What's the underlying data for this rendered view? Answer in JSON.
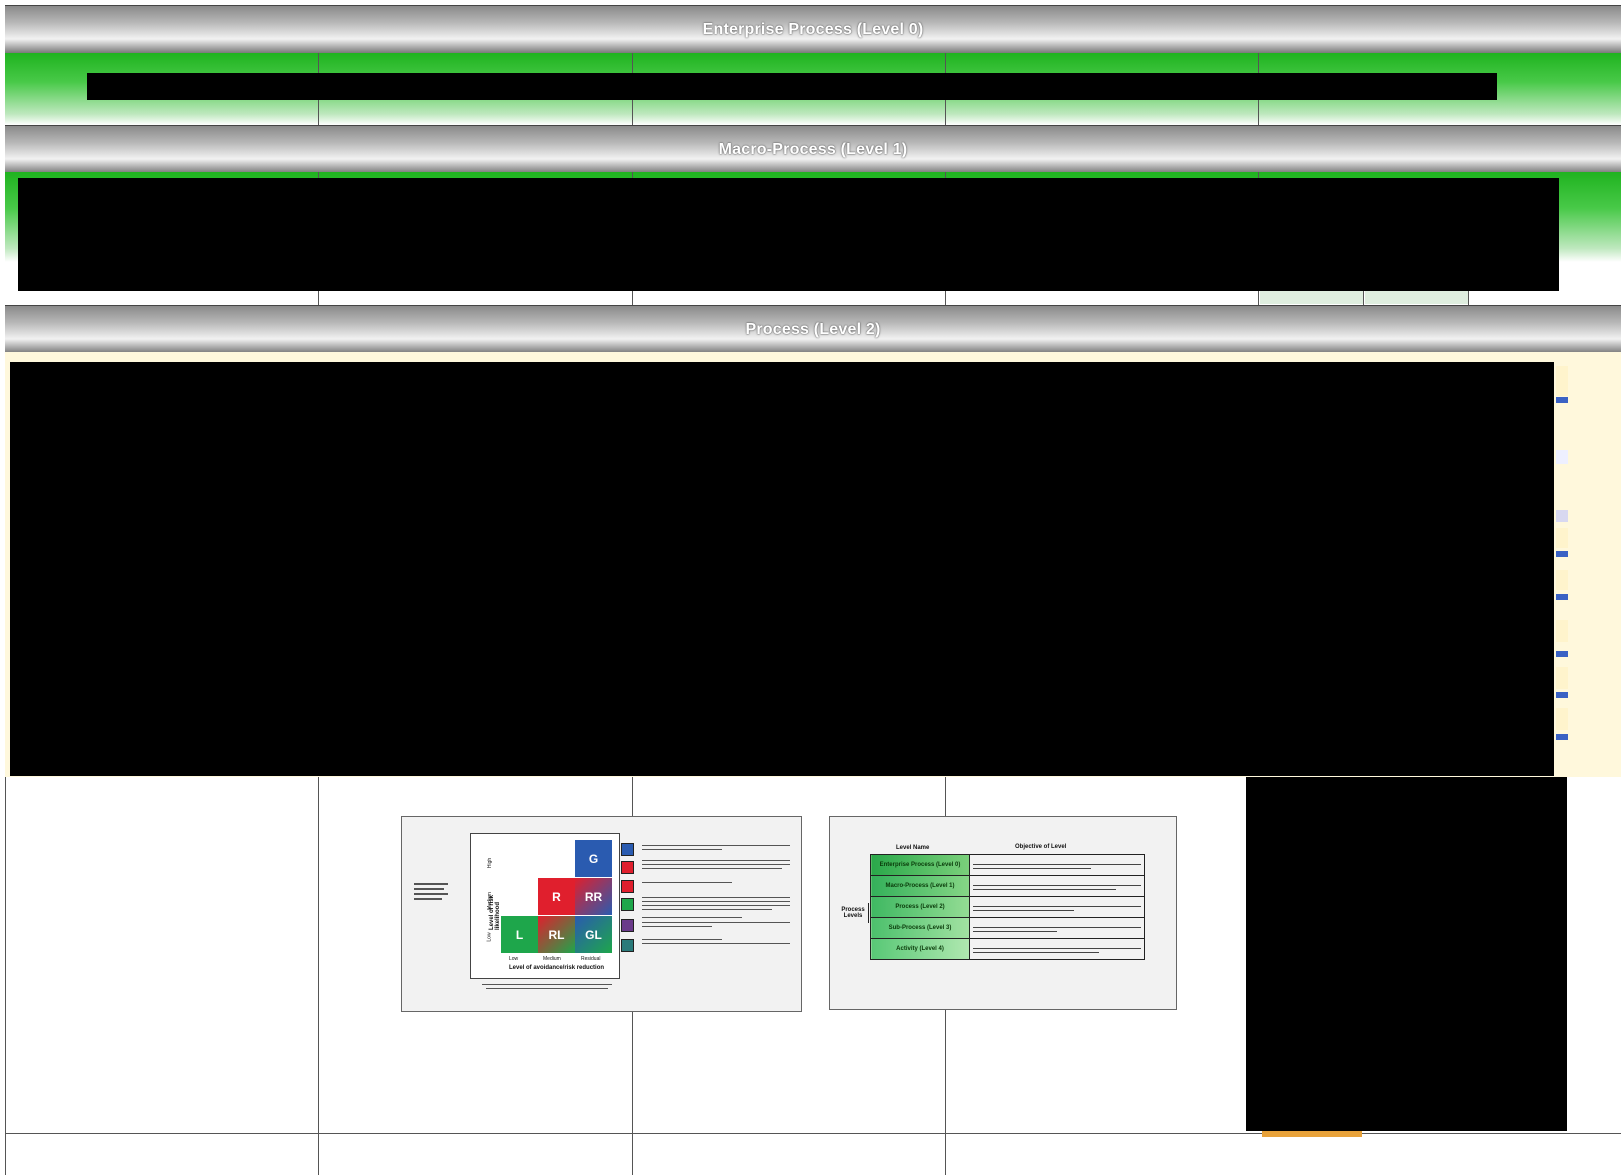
{
  "headers": {
    "level0": "Enterprise Process (Level 0)",
    "level1": "Macro-Process (Level 1)",
    "level2": "Process (Level 2)"
  },
  "risk_matrix": {
    "y_axis_title": "Level of risk likelihood",
    "x_axis_title": "Level of avoidance/risk reduction",
    "x_ticks": [
      "Low",
      "Medium",
      "Residual"
    ],
    "y_ticks": [
      "Low",
      "Medium",
      "High"
    ],
    "cells": {
      "top_right": "G",
      "mid_middle": "R",
      "mid_right": "RR",
      "bottom_left": "L",
      "bottom_middle": "RL",
      "bottom_right": "GL"
    },
    "colors": {
      "blue": "#2a5bb0",
      "red": "#e01f2d",
      "green": "#1ea64b",
      "purple": "#6a3a8a"
    }
  },
  "level_table": {
    "col_header_name": "Level Name",
    "col_header_objective": "Objective of Level",
    "side_label": "Process Levels",
    "rows": [
      {
        "name": "Enterprise Process (Level 0)"
      },
      {
        "name": "Macro-Process (Level 1)"
      },
      {
        "name": "Process (Level 2)"
      },
      {
        "name": "Sub-Process (Level 3)"
      },
      {
        "name": "Activity (Level 4)"
      }
    ]
  }
}
